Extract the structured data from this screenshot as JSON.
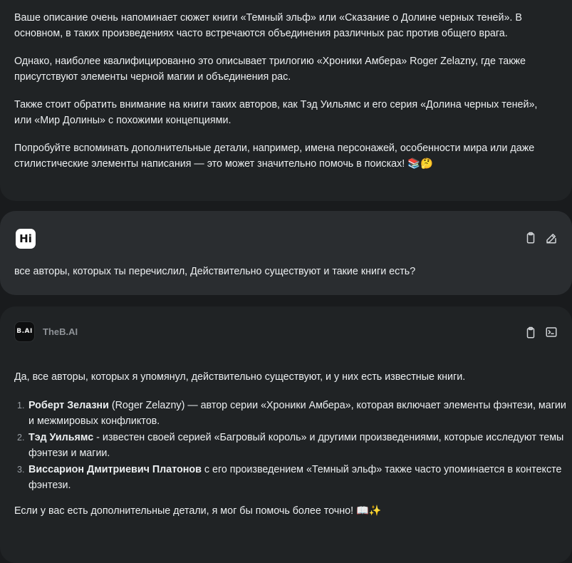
{
  "previous_message": {
    "paragraphs": [
      "Ваше описание очень напоминает сюжет книги «Темный эльф» или «Сказание о Долине черных теней». В основном, в таких произведениях часто встречаются объединения различных рас против общего врага.",
      "Однако, наиболее квалифицированно это описывает трилогию «Хроники Амбера» Roger Zelazny, где также присутствуют элементы черной магии и объединения рас.",
      "Также стоит обратить внимание на книги таких авторов, как Тэд Уильямс и его серия «Долина черных теней», или «Мир Долины» с похожими концепциями.",
      "Попробуйте вспоминать дополнительные детали, например, имена персонажей, особенности мира или даже стилистические элементы написания — это может значительно помочь в поисках! 📚🤔"
    ]
  },
  "user_message": {
    "avatar_text": "Hi",
    "text": "все авторы, которых ты перечислил, Действительно существуют и такие книги есть?",
    "actions": [
      "copy-icon",
      "edit-icon"
    ]
  },
  "bot_message": {
    "avatar_text": "B.AI",
    "bot_name": "TheB.AI",
    "actions": [
      "copy-icon",
      "terminal-icon"
    ],
    "intro": "Да, все авторы, которых я упомянул, действительно существуют, и у них есть известные книги.",
    "items": [
      {
        "num": "1.",
        "bold": "Роберт Зелазни",
        "rest": " (Roger Zelazny) — автор серии «Хроники Амбера», которая включает элементы фэнтези, магии и межмировых конфликтов."
      },
      {
        "num": "2.",
        "bold": "Тэд Уильямс",
        "rest": " - известен своей серией «Багровый король» и другими произведениями, которые исследуют темы фэнтези и магии."
      },
      {
        "num": "3.",
        "bold": "Виссарион Дмитриевич Платонов",
        "rest": " с его произведением «Темный эльф» также часто упоминается в контексте фэнтези."
      }
    ],
    "outro": "Если у вас есть дополнительные детали, я мог бы помочь более точно! 📖✨"
  },
  "colors": {
    "page_bg": "#191b1d",
    "bot_card_bg": "#202325",
    "user_card_bg": "#2a2d30",
    "text": "#eceff1",
    "muted": "#8e9297"
  }
}
